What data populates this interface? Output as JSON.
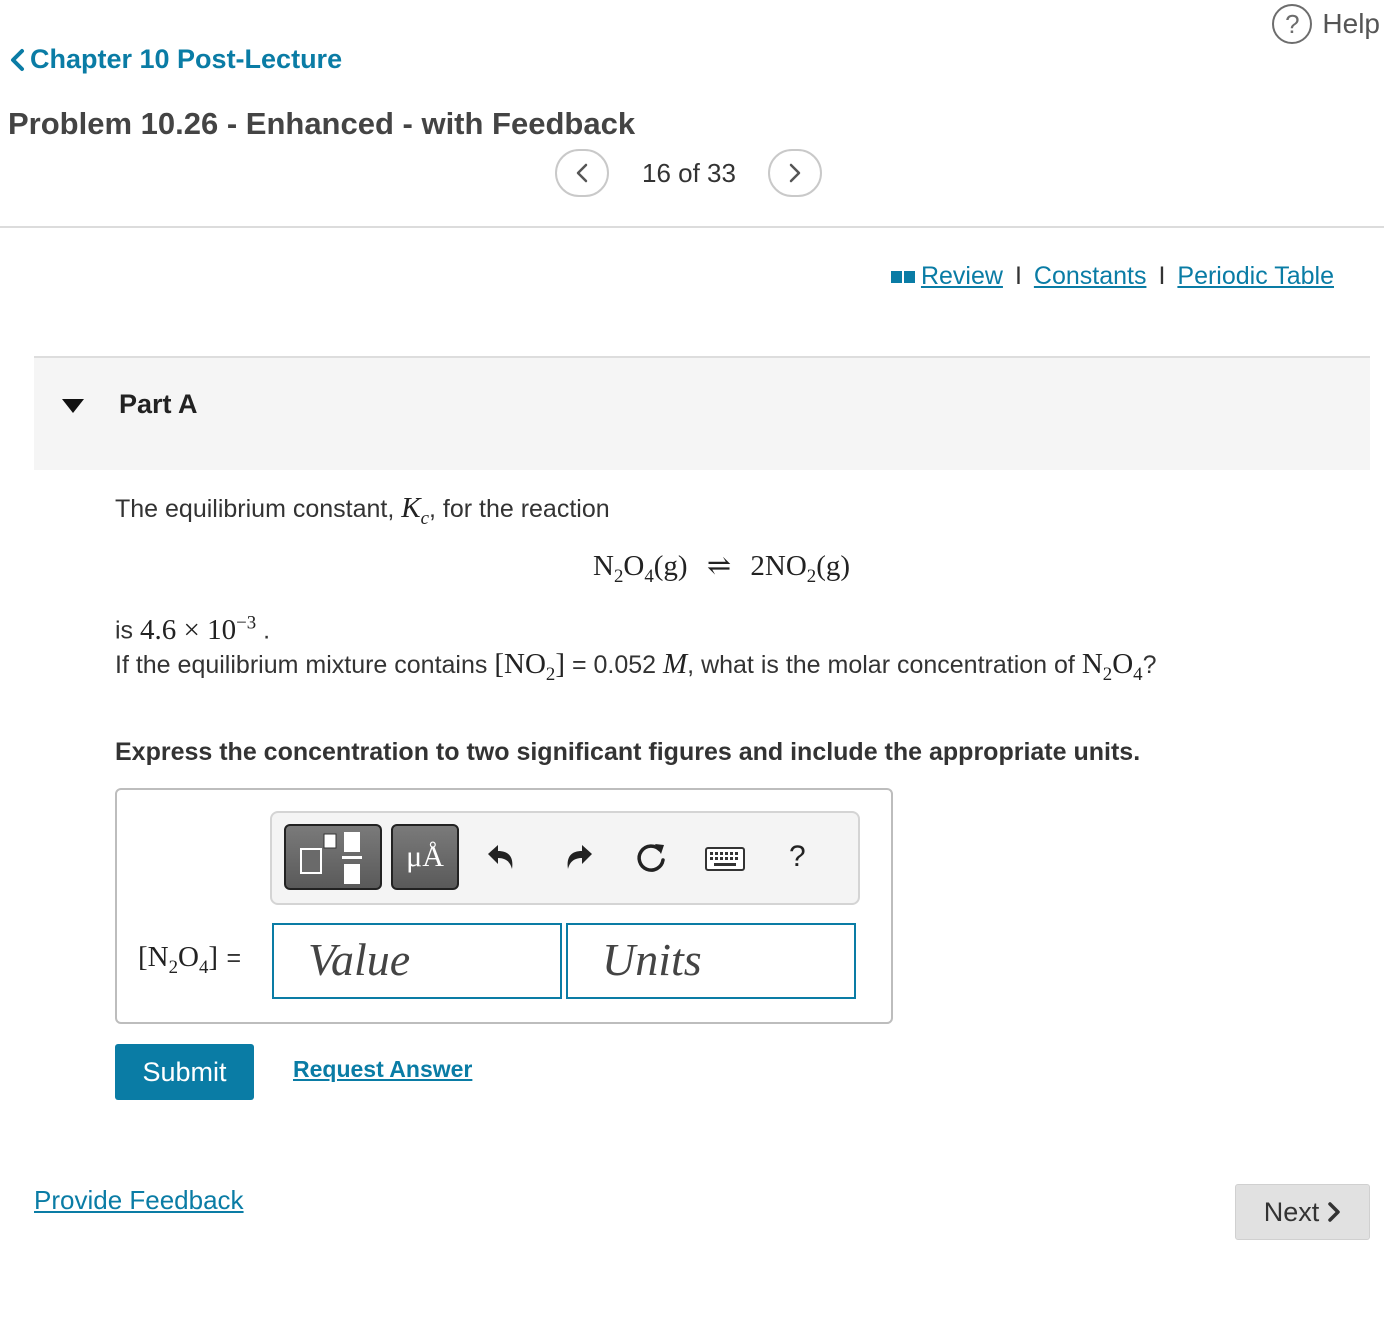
{
  "header": {
    "help_label": "Help",
    "back_label": "Chapter 10 Post-Lecture",
    "title": "Problem 10.26 - Enhanced - with Feedback",
    "pager": "16 of 33"
  },
  "resources": {
    "review": "Review",
    "separator": "I",
    "constants": "Constants",
    "periodic_table": "Periodic Table"
  },
  "part": {
    "label": "Part A"
  },
  "problem": {
    "intro_text": "The equilibrium constant,",
    "kc_symbol": "K",
    "kc_sub": "c",
    "intro_end": ", for the reaction",
    "reaction": {
      "reactant": "N",
      "reactant_sub1": "2",
      "reactant_o": "O",
      "reactant_sub2": "4",
      "reactant_state": "(g)",
      "arrow": "⇌",
      "product": "2NO",
      "product_sub": "2",
      "product_state": "(g)"
    },
    "is_text": "is",
    "k_value": "4.6 × 10",
    "k_exp": "−3",
    "period": ".",
    "line2_start": "If the equilibrium mixture contains",
    "no2_label": "[NO",
    "no2_sub": "2",
    "no2_close": "]",
    "line2_mid": "= 0.052",
    "molar": "M",
    "line2_end": ", what is the molar concentration of",
    "target": "N",
    "target_sub1": "2",
    "target_o": "O",
    "target_sub2": "4",
    "question_mark": "?"
  },
  "instruction": "Express the concentration to two significant figures and include the appropriate units.",
  "answer": {
    "toolbar": {
      "template_icon": "fraction-template-icon",
      "units_label": "μÅ",
      "undo_icon": "undo-icon",
      "redo_icon": "redo-icon",
      "reset_icon": "reset-icon",
      "keyboard_icon": "keyboard-icon",
      "help_label": "?"
    },
    "lhs_open": "[N",
    "lhs_sub1": "2",
    "lhs_o": "O",
    "lhs_sub2": "4",
    "lhs_close": "]",
    "equals": "=",
    "value_placeholder": "Value",
    "units_placeholder": "Units"
  },
  "actions": {
    "submit": "Submit",
    "request_answer": "Request Answer",
    "provide_feedback": "Provide Feedback",
    "next": "Next"
  },
  "colors": {
    "accent": "#0a7ca5",
    "part_bar_bg": "#f5f5f5",
    "next_bg": "#e1e1e1"
  }
}
